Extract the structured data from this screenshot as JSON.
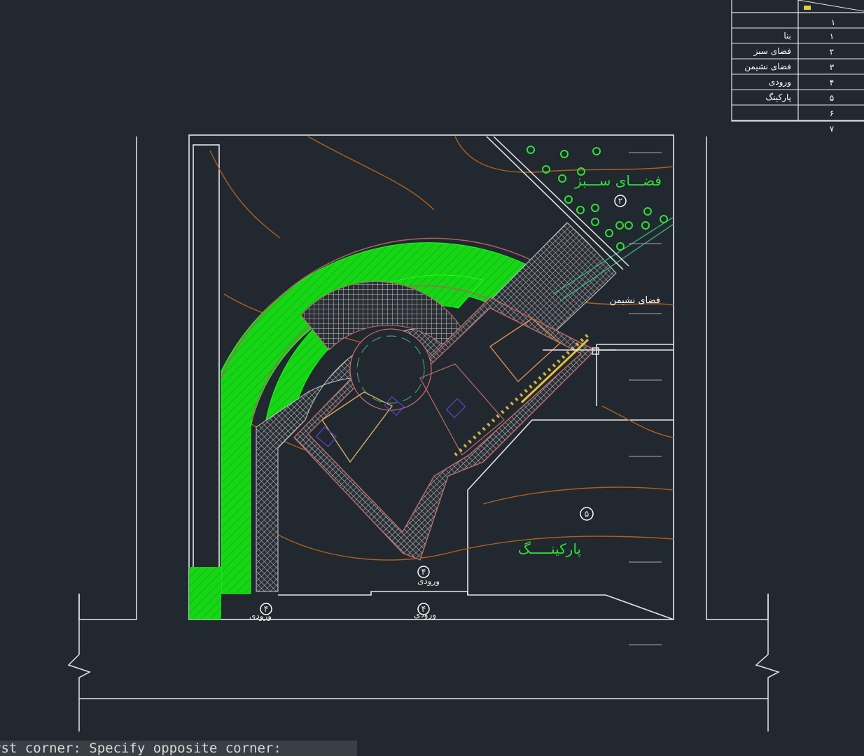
{
  "labels": {
    "green_space": "فضـــای ســـبز",
    "sitting_space": "فضای نشیمن",
    "parking": "پارکینـــــگ",
    "entrance": "ورودی",
    "entrance_2": "ورودی"
  },
  "circle_markers": {
    "green": "۲",
    "parking": "۵",
    "entry_mid": "۴",
    "entry_left": "۴",
    "entry_right": "۴"
  },
  "legend": {
    "header_number": "۱",
    "rows": [
      {
        "name": "بنا",
        "num": "۱"
      },
      {
        "name": "فضای سبز",
        "num": "۲"
      },
      {
        "name": "فضای نشیمن",
        "num": "۳"
      },
      {
        "name": "ورودی",
        "num": "۴"
      },
      {
        "name": "پارکینگ",
        "num": "۵"
      },
      {
        "name": "",
        "num": "۶"
      },
      {
        "name": "",
        "num": "۷"
      }
    ]
  },
  "command_line": "rst corner: Specify opposite corner:",
  "colors": {
    "background": "#212830",
    "lines": "#e6e6e6",
    "green_fill": "#18e018",
    "contour": "#b0601c",
    "building": "#c06a6a",
    "hatch_grid": "#c8c8c8"
  }
}
